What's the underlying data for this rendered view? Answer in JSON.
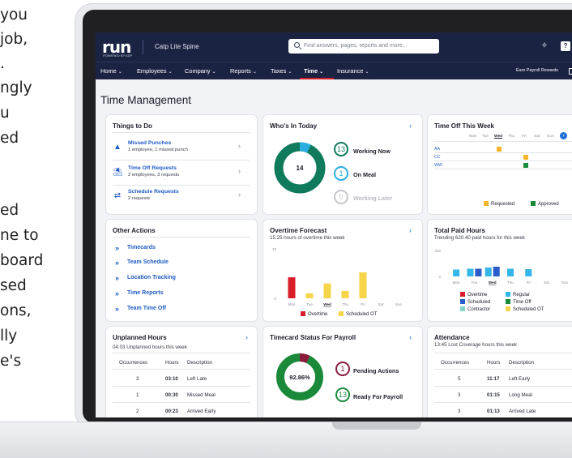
{
  "side_text": [
    "you",
    "job,",
    ".",
    "ngly",
    "u",
    "ed",
    "ed",
    "ne to",
    "board",
    "sed",
    "ons,",
    "lly",
    "e's"
  ],
  "app": {
    "logo": "run",
    "logo_sub": "POWERED BY ADP",
    "company": "Catp Lite Spine",
    "search_placeholder": "Find answers, pages, reports and more...",
    "help": "?",
    "earn": "Earn Payroll Rewards"
  },
  "menu": [
    {
      "label": "Home",
      "active": false
    },
    {
      "label": "Employees",
      "active": false
    },
    {
      "label": "Company",
      "active": false
    },
    {
      "label": "Reports",
      "active": false
    },
    {
      "label": "Taxes",
      "active": false
    },
    {
      "label": "Time",
      "active": true
    },
    {
      "label": "Insurance",
      "active": false
    }
  ],
  "page_title": "Time Management",
  "things_to_do": {
    "title": "Things to Do",
    "items": [
      {
        "title": "Missed Punches",
        "detail": "1 employee, 1 missed punch",
        "icon": "warning-icon"
      },
      {
        "title": "Time Off Requests",
        "detail": "2 employees, 3 requests",
        "icon": "beach-icon"
      },
      {
        "title": "Schedule Requests",
        "detail": "2 requests",
        "icon": "swap-icon"
      }
    ]
  },
  "other_actions": {
    "title": "Other Actions",
    "items": [
      "Timecards",
      "Team Schedule",
      "Location Tracking",
      "Time Reports",
      "Team Time Off"
    ]
  },
  "unplanned": {
    "title": "Unplanned Hours",
    "subtitle": "04:03 Unplanned hours this week",
    "headers": [
      "Occurrences",
      "Hours",
      "Description"
    ],
    "rows": [
      [
        "3",
        "03:10",
        "Left Late"
      ],
      [
        "1",
        "00:30",
        "Missed Meal"
      ],
      [
        "2",
        "00:23",
        "Arrived Early"
      ]
    ]
  },
  "whos_in": {
    "title": "Who's In Today",
    "center": "14",
    "donut": {
      "working": 13,
      "meal": 1,
      "later": 0
    },
    "statuses": [
      {
        "count": "13",
        "label": "Working Now",
        "color": "#0f7a5c"
      },
      {
        "count": "1",
        "label": "On Meal",
        "color": "#2aaee0"
      },
      {
        "count": "0",
        "label": "Working Later",
        "color": "#c4c6cd"
      }
    ]
  },
  "overtime": {
    "title": "Overtime Forecast",
    "subtitle": "15.25 hours of overtime this week"
  },
  "timecard": {
    "title": "Timecard Status For Payroll",
    "center": "92.86%",
    "statuses": [
      {
        "count": "1",
        "label": "Pending Actions",
        "color": "#8a1c3a"
      },
      {
        "count": "13",
        "label": "Ready For Payroll",
        "color": "#1a8a3a"
      }
    ]
  },
  "time_off": {
    "title": "Time Off This Week",
    "days": [
      "Mon",
      "Tue",
      "Wed",
      "Thu",
      "Fri",
      "Sat",
      "Sun"
    ],
    "employees": [
      "AA",
      "CC",
      "WW"
    ],
    "legend": [
      "Requested",
      "Approved"
    ]
  },
  "total_paid": {
    "title": "Total Paid Hours",
    "subtitle": "Trending 620.40 paid hours for this week",
    "legend": [
      "Overtime",
      "Regular",
      "Scheduled",
      "Time Off",
      "Contractor",
      "Scheduled OT"
    ]
  },
  "attendance": {
    "title": "Attendance",
    "subtitle": "13:45 Lost Coverage hours this week",
    "headers": [
      "Occurrences",
      "Hours",
      "Description"
    ],
    "rows": [
      [
        "5",
        "11:17",
        "Left Early"
      ],
      [
        "3",
        "01:15",
        "Long Meal"
      ],
      [
        "3",
        "01:13",
        "Arrived Late"
      ]
    ]
  },
  "chart_data": [
    {
      "type": "bar",
      "title": "Overtime Forecast",
      "categories": [
        "Mon",
        "Tue",
        "Wed",
        "Thu",
        "Fri",
        "Sat",
        "Sun"
      ],
      "highlight": "Wed",
      "ylim": [
        0,
        10
      ],
      "yticks": [
        "10",
        "0"
      ],
      "series": [
        {
          "name": "Overtime",
          "color": "#d81e2a",
          "values": [
            4.25,
            0,
            0,
            0,
            0,
            0,
            0
          ]
        },
        {
          "name": "Scheduled OT",
          "color": "#f6d54a",
          "values": [
            0,
            1,
            3,
            1.5,
            5.25,
            0,
            0
          ]
        }
      ]
    },
    {
      "type": "bar",
      "title": "Total Paid Hours",
      "categories": [
        "Mon",
        "Tue",
        "Wed",
        "Thu",
        "Fri",
        "Sat",
        "Sun"
      ],
      "highlight": "Wed",
      "ylim": [
        0,
        320
      ],
      "yticks": [
        "320",
        "0"
      ],
      "series": [
        {
          "name": "Regular",
          "color": "#35b6ea",
          "values": [
            85,
            95,
            110,
            95,
            90,
            0,
            0
          ]
        },
        {
          "name": "Scheduled",
          "color": "#2a5ccc",
          "values": [
            0,
            95,
            120,
            0,
            0,
            0,
            0
          ]
        }
      ]
    }
  ]
}
